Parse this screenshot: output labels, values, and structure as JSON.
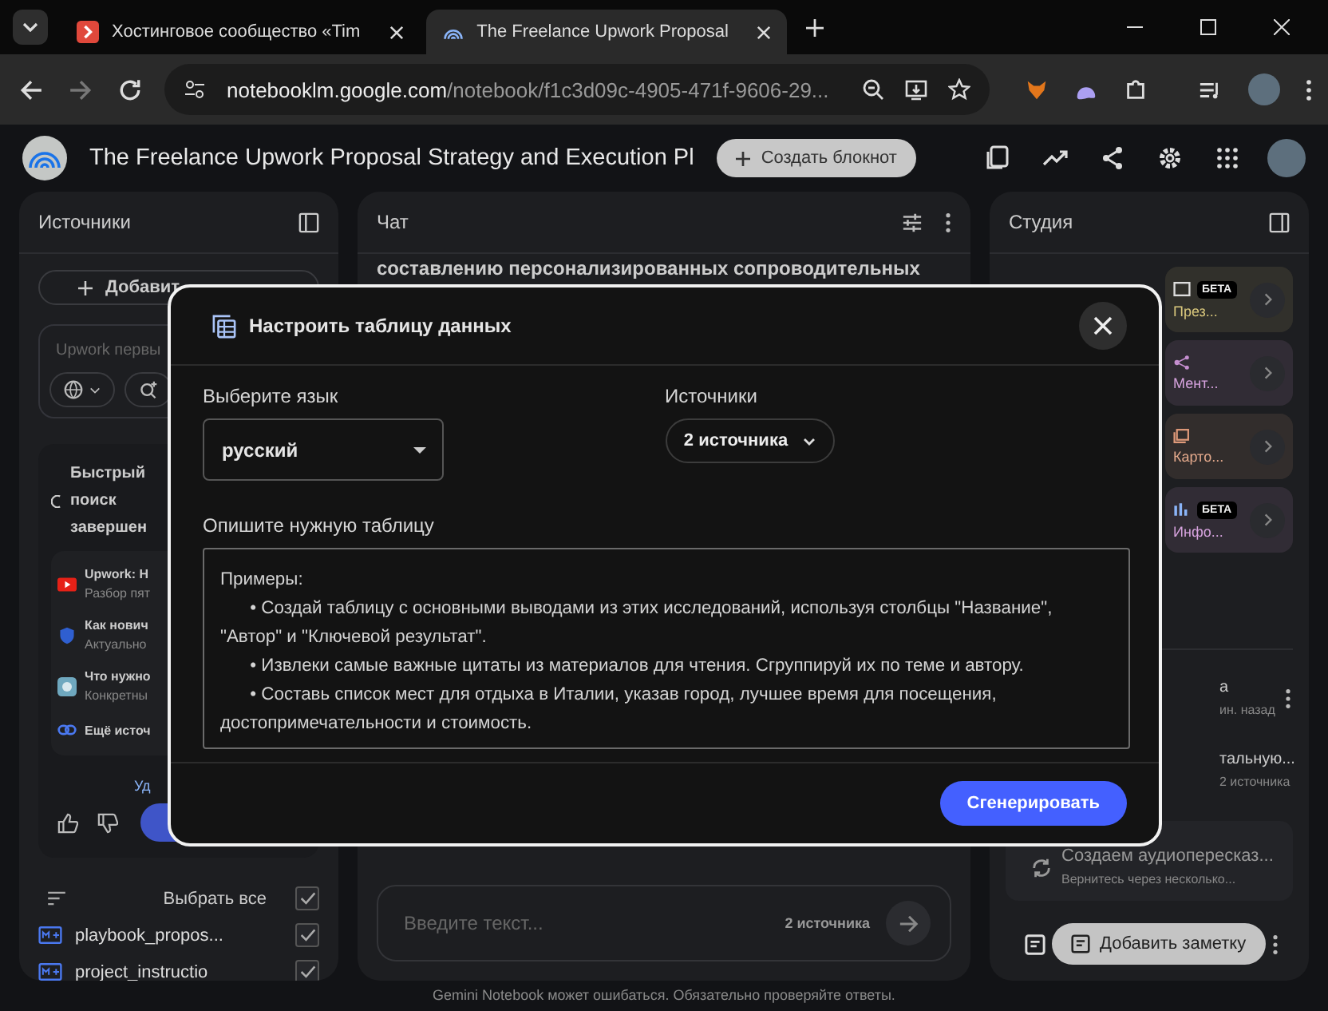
{
  "browser": {
    "tabs": [
      {
        "kind": "site",
        "title": "Хостинговое сообщество «Tim",
        "selected": false
      },
      {
        "kind": "notebook",
        "title": "The Freelance Upwork Proposal",
        "selected": true
      }
    ],
    "address": {
      "host": "notebooklm.google.com",
      "path": "/notebook/f1c3d09c-4905-471f-9606-29..."
    }
  },
  "app_header": {
    "title": "The Freelance Upwork Proposal Strategy and Execution Pl",
    "create_button": "Создать блокнот"
  },
  "sources_panel": {
    "title": "Источники",
    "add_button": "Добавит",
    "search": {
      "placeholder": "Upwork первы"
    },
    "search_card": {
      "status": "Быстрый поиск завершен",
      "results": [
        {
          "kind": "video",
          "title": "Upwork: H",
          "subtitle": "Разбор пят"
        },
        {
          "kind": "shield",
          "title": "Как нович",
          "subtitle": "Актуально"
        },
        {
          "kind": "site",
          "title": "Что нужно",
          "subtitle": "Конкретны"
        }
      ],
      "more_link": "Ещё источ",
      "action_text": "Уд"
    },
    "select_all": {
      "label": "Выбрать все",
      "checked": true
    },
    "sources": [
      {
        "name": "playbook_propos...",
        "checked": true
      },
      {
        "name": "project_instructio",
        "checked": true
      }
    ]
  },
  "chat_panel": {
    "title": "Чат",
    "message_fragment": "составлению персонализированных сопроводительных",
    "input": {
      "placeholder": "Введите текст...",
      "sources_count": "2 источника"
    }
  },
  "studio_panel": {
    "title": "Студия",
    "tiles": [
      {
        "kind": "slides",
        "label": "През...",
        "badge": "БЕТА",
        "color": "#d9c77c"
      },
      {
        "kind": "mindmap",
        "label": "Мент...",
        "color": "#d7a3df"
      },
      {
        "kind": "cards",
        "label": "Карто...",
        "color": "#e3a98c"
      },
      {
        "kind": "infographic",
        "label": "Инфо...",
        "badge": "БЕТА",
        "color": "#d7a3df"
      }
    ],
    "items": [
      {
        "kind": "table",
        "title": "а",
        "meta": "ин. назад"
      },
      {
        "kind": "report",
        "title": "тальную...",
        "meta": "2 источника"
      },
      {
        "kind": "audio",
        "title": "Создаем аудиопересказ...",
        "meta": "Вернитесь через несколько..."
      }
    ],
    "add_note_button": "Добавить заметку"
  },
  "disclaimer": "Gemini Notebook может ошибаться. Обязательно проверяйте ответы.",
  "dialog": {
    "title": "Настроить таблицу данных",
    "language": {
      "label": "Выберите язык",
      "value": "русский"
    },
    "sources": {
      "label": "Источники",
      "value": "2 источника"
    },
    "description": {
      "label": "Опишите нужную таблицу",
      "placeholder": "Примеры:\n\t• Создай таблицу с основными выводами из этих исследований, используя столбцы \"Название\", \"Автор\" и \"Ключевой результат\".\n\t• Извлеки самые важные цитаты из материалов для чтения. Сгруппируй их по теме и автору.\n\t• Составь список мест для отдыха в Италии, указав город, лучшее время для посещения, достопримечательности и стоимость."
    },
    "generate_button": "Сгенерировать"
  }
}
